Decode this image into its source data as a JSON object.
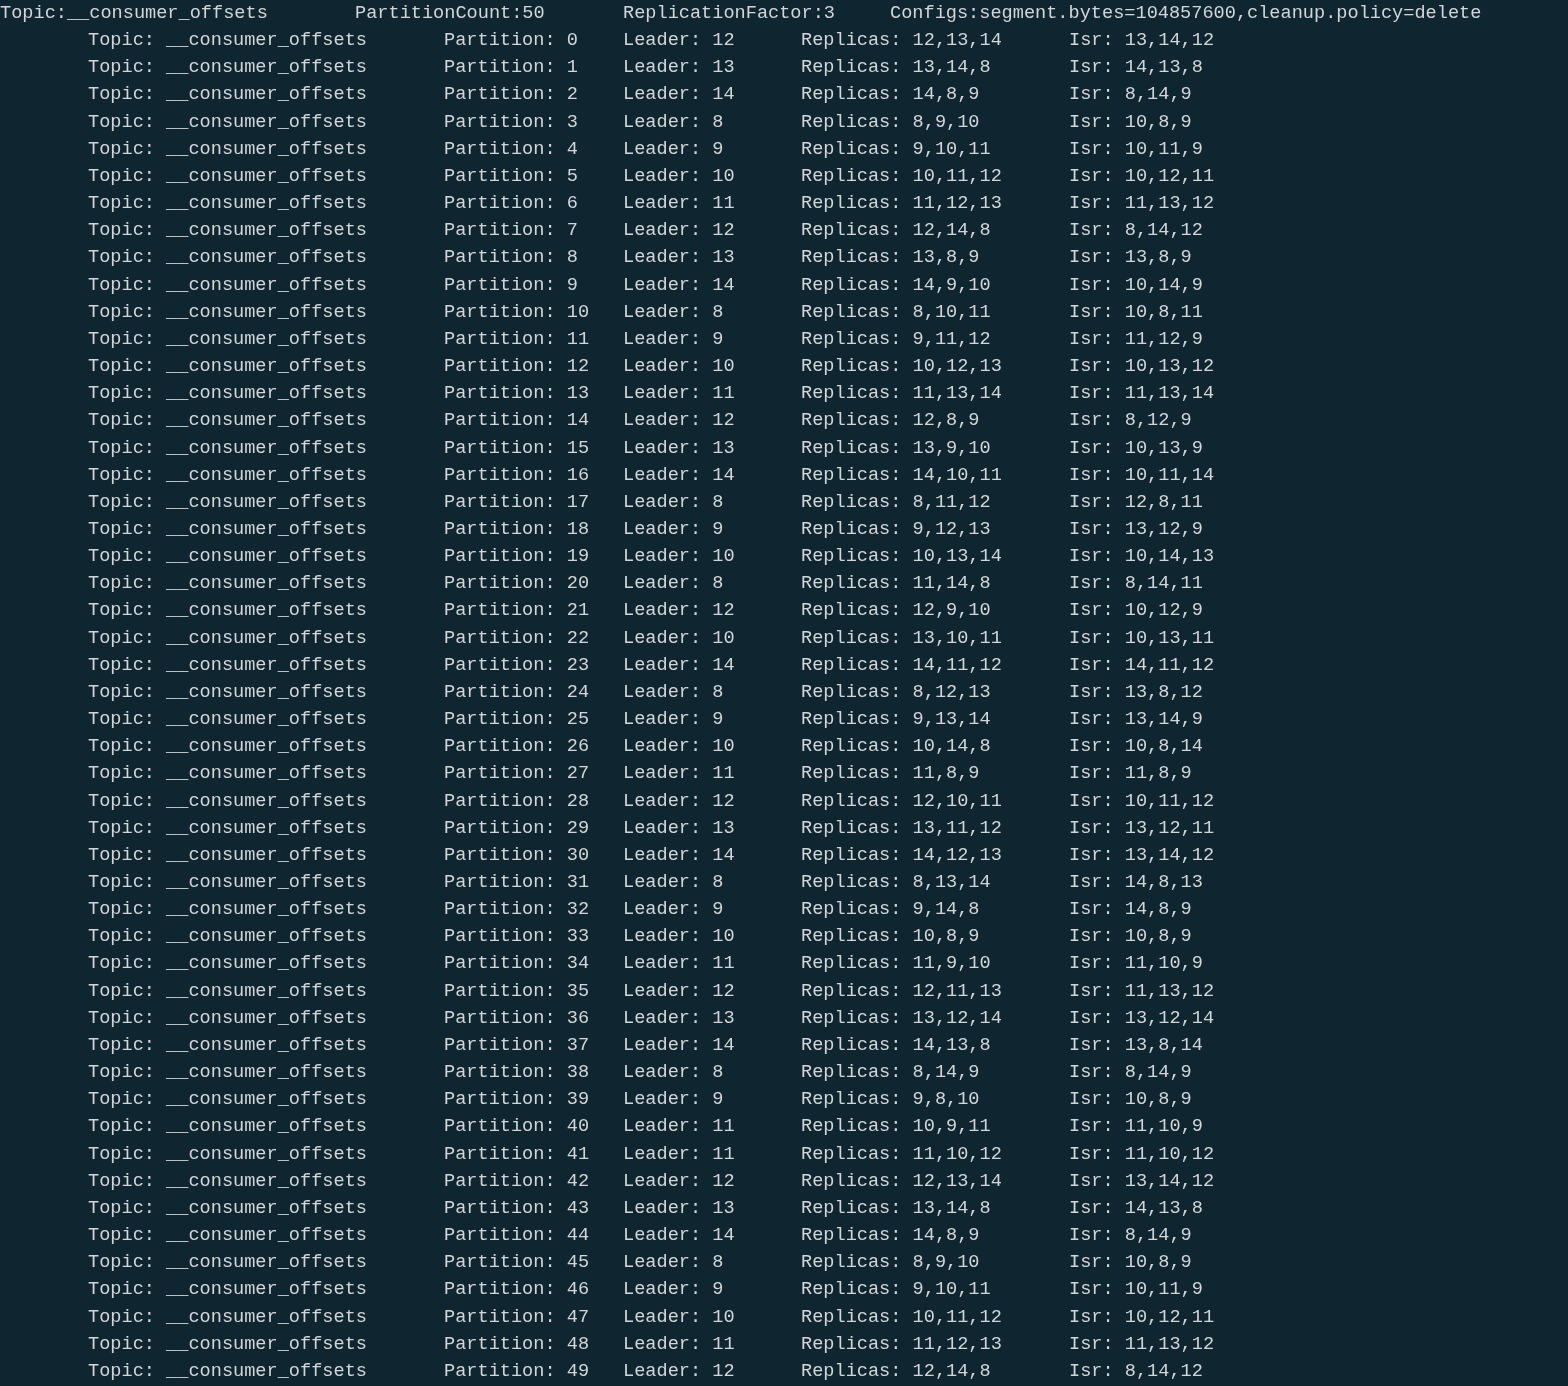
{
  "header": {
    "topic": "Topic:__consumer_offsets",
    "partition_count": "PartitionCount:50",
    "replication_factor": "ReplicationFactor:3",
    "configs": "Configs:segment.bytes=104857600,cleanup.policy=delete"
  },
  "partitions": [
    {
      "topic": "Topic: __consumer_offsets",
      "partition": "Partition: 0",
      "leader": "Leader: 12",
      "replicas": "Replicas: 12,13,14",
      "isr": "Isr: 13,14,12"
    },
    {
      "topic": "Topic: __consumer_offsets",
      "partition": "Partition: 1",
      "leader": "Leader: 13",
      "replicas": "Replicas: 13,14,8",
      "isr": "Isr: 14,13,8"
    },
    {
      "topic": "Topic: __consumer_offsets",
      "partition": "Partition: 2",
      "leader": "Leader: 14",
      "replicas": "Replicas: 14,8,9",
      "isr": "Isr: 8,14,9"
    },
    {
      "topic": "Topic: __consumer_offsets",
      "partition": "Partition: 3",
      "leader": "Leader: 8",
      "replicas": "Replicas: 8,9,10",
      "isr": "Isr: 10,8,9"
    },
    {
      "topic": "Topic: __consumer_offsets",
      "partition": "Partition: 4",
      "leader": "Leader: 9",
      "replicas": "Replicas: 9,10,11",
      "isr": "Isr: 10,11,9"
    },
    {
      "topic": "Topic: __consumer_offsets",
      "partition": "Partition: 5",
      "leader": "Leader: 10",
      "replicas": "Replicas: 10,11,12",
      "isr": "Isr: 10,12,11"
    },
    {
      "topic": "Topic: __consumer_offsets",
      "partition": "Partition: 6",
      "leader": "Leader: 11",
      "replicas": "Replicas: 11,12,13",
      "isr": "Isr: 11,13,12"
    },
    {
      "topic": "Topic: __consumer_offsets",
      "partition": "Partition: 7",
      "leader": "Leader: 12",
      "replicas": "Replicas: 12,14,8",
      "isr": "Isr: 8,14,12"
    },
    {
      "topic": "Topic: __consumer_offsets",
      "partition": "Partition: 8",
      "leader": "Leader: 13",
      "replicas": "Replicas: 13,8,9",
      "isr": "Isr: 13,8,9"
    },
    {
      "topic": "Topic: __consumer_offsets",
      "partition": "Partition: 9",
      "leader": "Leader: 14",
      "replicas": "Replicas: 14,9,10",
      "isr": "Isr: 10,14,9"
    },
    {
      "topic": "Topic: __consumer_offsets",
      "partition": "Partition: 10",
      "leader": "Leader: 8",
      "replicas": "Replicas: 8,10,11",
      "isr": "Isr: 10,8,11"
    },
    {
      "topic": "Topic: __consumer_offsets",
      "partition": "Partition: 11",
      "leader": "Leader: 9",
      "replicas": "Replicas: 9,11,12",
      "isr": "Isr: 11,12,9"
    },
    {
      "topic": "Topic: __consumer_offsets",
      "partition": "Partition: 12",
      "leader": "Leader: 10",
      "replicas": "Replicas: 10,12,13",
      "isr": "Isr: 10,13,12"
    },
    {
      "topic": "Topic: __consumer_offsets",
      "partition": "Partition: 13",
      "leader": "Leader: 11",
      "replicas": "Replicas: 11,13,14",
      "isr": "Isr: 11,13,14"
    },
    {
      "topic": "Topic: __consumer_offsets",
      "partition": "Partition: 14",
      "leader": "Leader: 12",
      "replicas": "Replicas: 12,8,9",
      "isr": "Isr: 8,12,9"
    },
    {
      "topic": "Topic: __consumer_offsets",
      "partition": "Partition: 15",
      "leader": "Leader: 13",
      "replicas": "Replicas: 13,9,10",
      "isr": "Isr: 10,13,9"
    },
    {
      "topic": "Topic: __consumer_offsets",
      "partition": "Partition: 16",
      "leader": "Leader: 14",
      "replicas": "Replicas: 14,10,11",
      "isr": "Isr: 10,11,14"
    },
    {
      "topic": "Topic: __consumer_offsets",
      "partition": "Partition: 17",
      "leader": "Leader: 8",
      "replicas": "Replicas: 8,11,12",
      "isr": "Isr: 12,8,11"
    },
    {
      "topic": "Topic: __consumer_offsets",
      "partition": "Partition: 18",
      "leader": "Leader: 9",
      "replicas": "Replicas: 9,12,13",
      "isr": "Isr: 13,12,9"
    },
    {
      "topic": "Topic: __consumer_offsets",
      "partition": "Partition: 19",
      "leader": "Leader: 10",
      "replicas": "Replicas: 10,13,14",
      "isr": "Isr: 10,14,13"
    },
    {
      "topic": "Topic: __consumer_offsets",
      "partition": "Partition: 20",
      "leader": "Leader: 8",
      "replicas": "Replicas: 11,14,8",
      "isr": "Isr: 8,14,11"
    },
    {
      "topic": "Topic: __consumer_offsets",
      "partition": "Partition: 21",
      "leader": "Leader: 12",
      "replicas": "Replicas: 12,9,10",
      "isr": "Isr: 10,12,9"
    },
    {
      "topic": "Topic: __consumer_offsets",
      "partition": "Partition: 22",
      "leader": "Leader: 10",
      "replicas": "Replicas: 13,10,11",
      "isr": "Isr: 10,13,11"
    },
    {
      "topic": "Topic: __consumer_offsets",
      "partition": "Partition: 23",
      "leader": "Leader: 14",
      "replicas": "Replicas: 14,11,12",
      "isr": "Isr: 14,11,12"
    },
    {
      "topic": "Topic: __consumer_offsets",
      "partition": "Partition: 24",
      "leader": "Leader: 8",
      "replicas": "Replicas: 8,12,13",
      "isr": "Isr: 13,8,12"
    },
    {
      "topic": "Topic: __consumer_offsets",
      "partition": "Partition: 25",
      "leader": "Leader: 9",
      "replicas": "Replicas: 9,13,14",
      "isr": "Isr: 13,14,9"
    },
    {
      "topic": "Topic: __consumer_offsets",
      "partition": "Partition: 26",
      "leader": "Leader: 10",
      "replicas": "Replicas: 10,14,8",
      "isr": "Isr: 10,8,14"
    },
    {
      "topic": "Topic: __consumer_offsets",
      "partition": "Partition: 27",
      "leader": "Leader: 11",
      "replicas": "Replicas: 11,8,9",
      "isr": "Isr: 11,8,9"
    },
    {
      "topic": "Topic: __consumer_offsets",
      "partition": "Partition: 28",
      "leader": "Leader: 12",
      "replicas": "Replicas: 12,10,11",
      "isr": "Isr: 10,11,12"
    },
    {
      "topic": "Topic: __consumer_offsets",
      "partition": "Partition: 29",
      "leader": "Leader: 13",
      "replicas": "Replicas: 13,11,12",
      "isr": "Isr: 13,12,11"
    },
    {
      "topic": "Topic: __consumer_offsets",
      "partition": "Partition: 30",
      "leader": "Leader: 14",
      "replicas": "Replicas: 14,12,13",
      "isr": "Isr: 13,14,12"
    },
    {
      "topic": "Topic: __consumer_offsets",
      "partition": "Partition: 31",
      "leader": "Leader: 8",
      "replicas": "Replicas: 8,13,14",
      "isr": "Isr: 14,8,13"
    },
    {
      "topic": "Topic: __consumer_offsets",
      "partition": "Partition: 32",
      "leader": "Leader: 9",
      "replicas": "Replicas: 9,14,8",
      "isr": "Isr: 14,8,9"
    },
    {
      "topic": "Topic: __consumer_offsets",
      "partition": "Partition: 33",
      "leader": "Leader: 10",
      "replicas": "Replicas: 10,8,9",
      "isr": "Isr: 10,8,9"
    },
    {
      "topic": "Topic: __consumer_offsets",
      "partition": "Partition: 34",
      "leader": "Leader: 11",
      "replicas": "Replicas: 11,9,10",
      "isr": "Isr: 11,10,9"
    },
    {
      "topic": "Topic: __consumer_offsets",
      "partition": "Partition: 35",
      "leader": "Leader: 12",
      "replicas": "Replicas: 12,11,13",
      "isr": "Isr: 11,13,12"
    },
    {
      "topic": "Topic: __consumer_offsets",
      "partition": "Partition: 36",
      "leader": "Leader: 13",
      "replicas": "Replicas: 13,12,14",
      "isr": "Isr: 13,12,14"
    },
    {
      "topic": "Topic: __consumer_offsets",
      "partition": "Partition: 37",
      "leader": "Leader: 14",
      "replicas": "Replicas: 14,13,8",
      "isr": "Isr: 13,8,14"
    },
    {
      "topic": "Topic: __consumer_offsets",
      "partition": "Partition: 38",
      "leader": "Leader: 8",
      "replicas": "Replicas: 8,14,9",
      "isr": "Isr: 8,14,9"
    },
    {
      "topic": "Topic: __consumer_offsets",
      "partition": "Partition: 39",
      "leader": "Leader: 9",
      "replicas": "Replicas: 9,8,10",
      "isr": "Isr: 10,8,9"
    },
    {
      "topic": "Topic: __consumer_offsets",
      "partition": "Partition: 40",
      "leader": "Leader: 11",
      "replicas": "Replicas: 10,9,11",
      "isr": "Isr: 11,10,9"
    },
    {
      "topic": "Topic: __consumer_offsets",
      "partition": "Partition: 41",
      "leader": "Leader: 11",
      "replicas": "Replicas: 11,10,12",
      "isr": "Isr: 11,10,12"
    },
    {
      "topic": "Topic: __consumer_offsets",
      "partition": "Partition: 42",
      "leader": "Leader: 12",
      "replicas": "Replicas: 12,13,14",
      "isr": "Isr: 13,14,12"
    },
    {
      "topic": "Topic: __consumer_offsets",
      "partition": "Partition: 43",
      "leader": "Leader: 13",
      "replicas": "Replicas: 13,14,8",
      "isr": "Isr: 14,13,8"
    },
    {
      "topic": "Topic: __consumer_offsets",
      "partition": "Partition: 44",
      "leader": "Leader: 14",
      "replicas": "Replicas: 14,8,9",
      "isr": "Isr: 8,14,9"
    },
    {
      "topic": "Topic: __consumer_offsets",
      "partition": "Partition: 45",
      "leader": "Leader: 8",
      "replicas": "Replicas: 8,9,10",
      "isr": "Isr: 10,8,9"
    },
    {
      "topic": "Topic: __consumer_offsets",
      "partition": "Partition: 46",
      "leader": "Leader: 9",
      "replicas": "Replicas: 9,10,11",
      "isr": "Isr: 10,11,9"
    },
    {
      "topic": "Topic: __consumer_offsets",
      "partition": "Partition: 47",
      "leader": "Leader: 10",
      "replicas": "Replicas: 10,11,12",
      "isr": "Isr: 10,12,11"
    },
    {
      "topic": "Topic: __consumer_offsets",
      "partition": "Partition: 48",
      "leader": "Leader: 11",
      "replicas": "Replicas: 11,12,13",
      "isr": "Isr: 11,13,12"
    },
    {
      "topic": "Topic: __consumer_offsets",
      "partition": "Partition: 49",
      "leader": "Leader: 12",
      "replicas": "Replicas: 12,14,8",
      "isr": "Isr: 8,14,12"
    }
  ]
}
